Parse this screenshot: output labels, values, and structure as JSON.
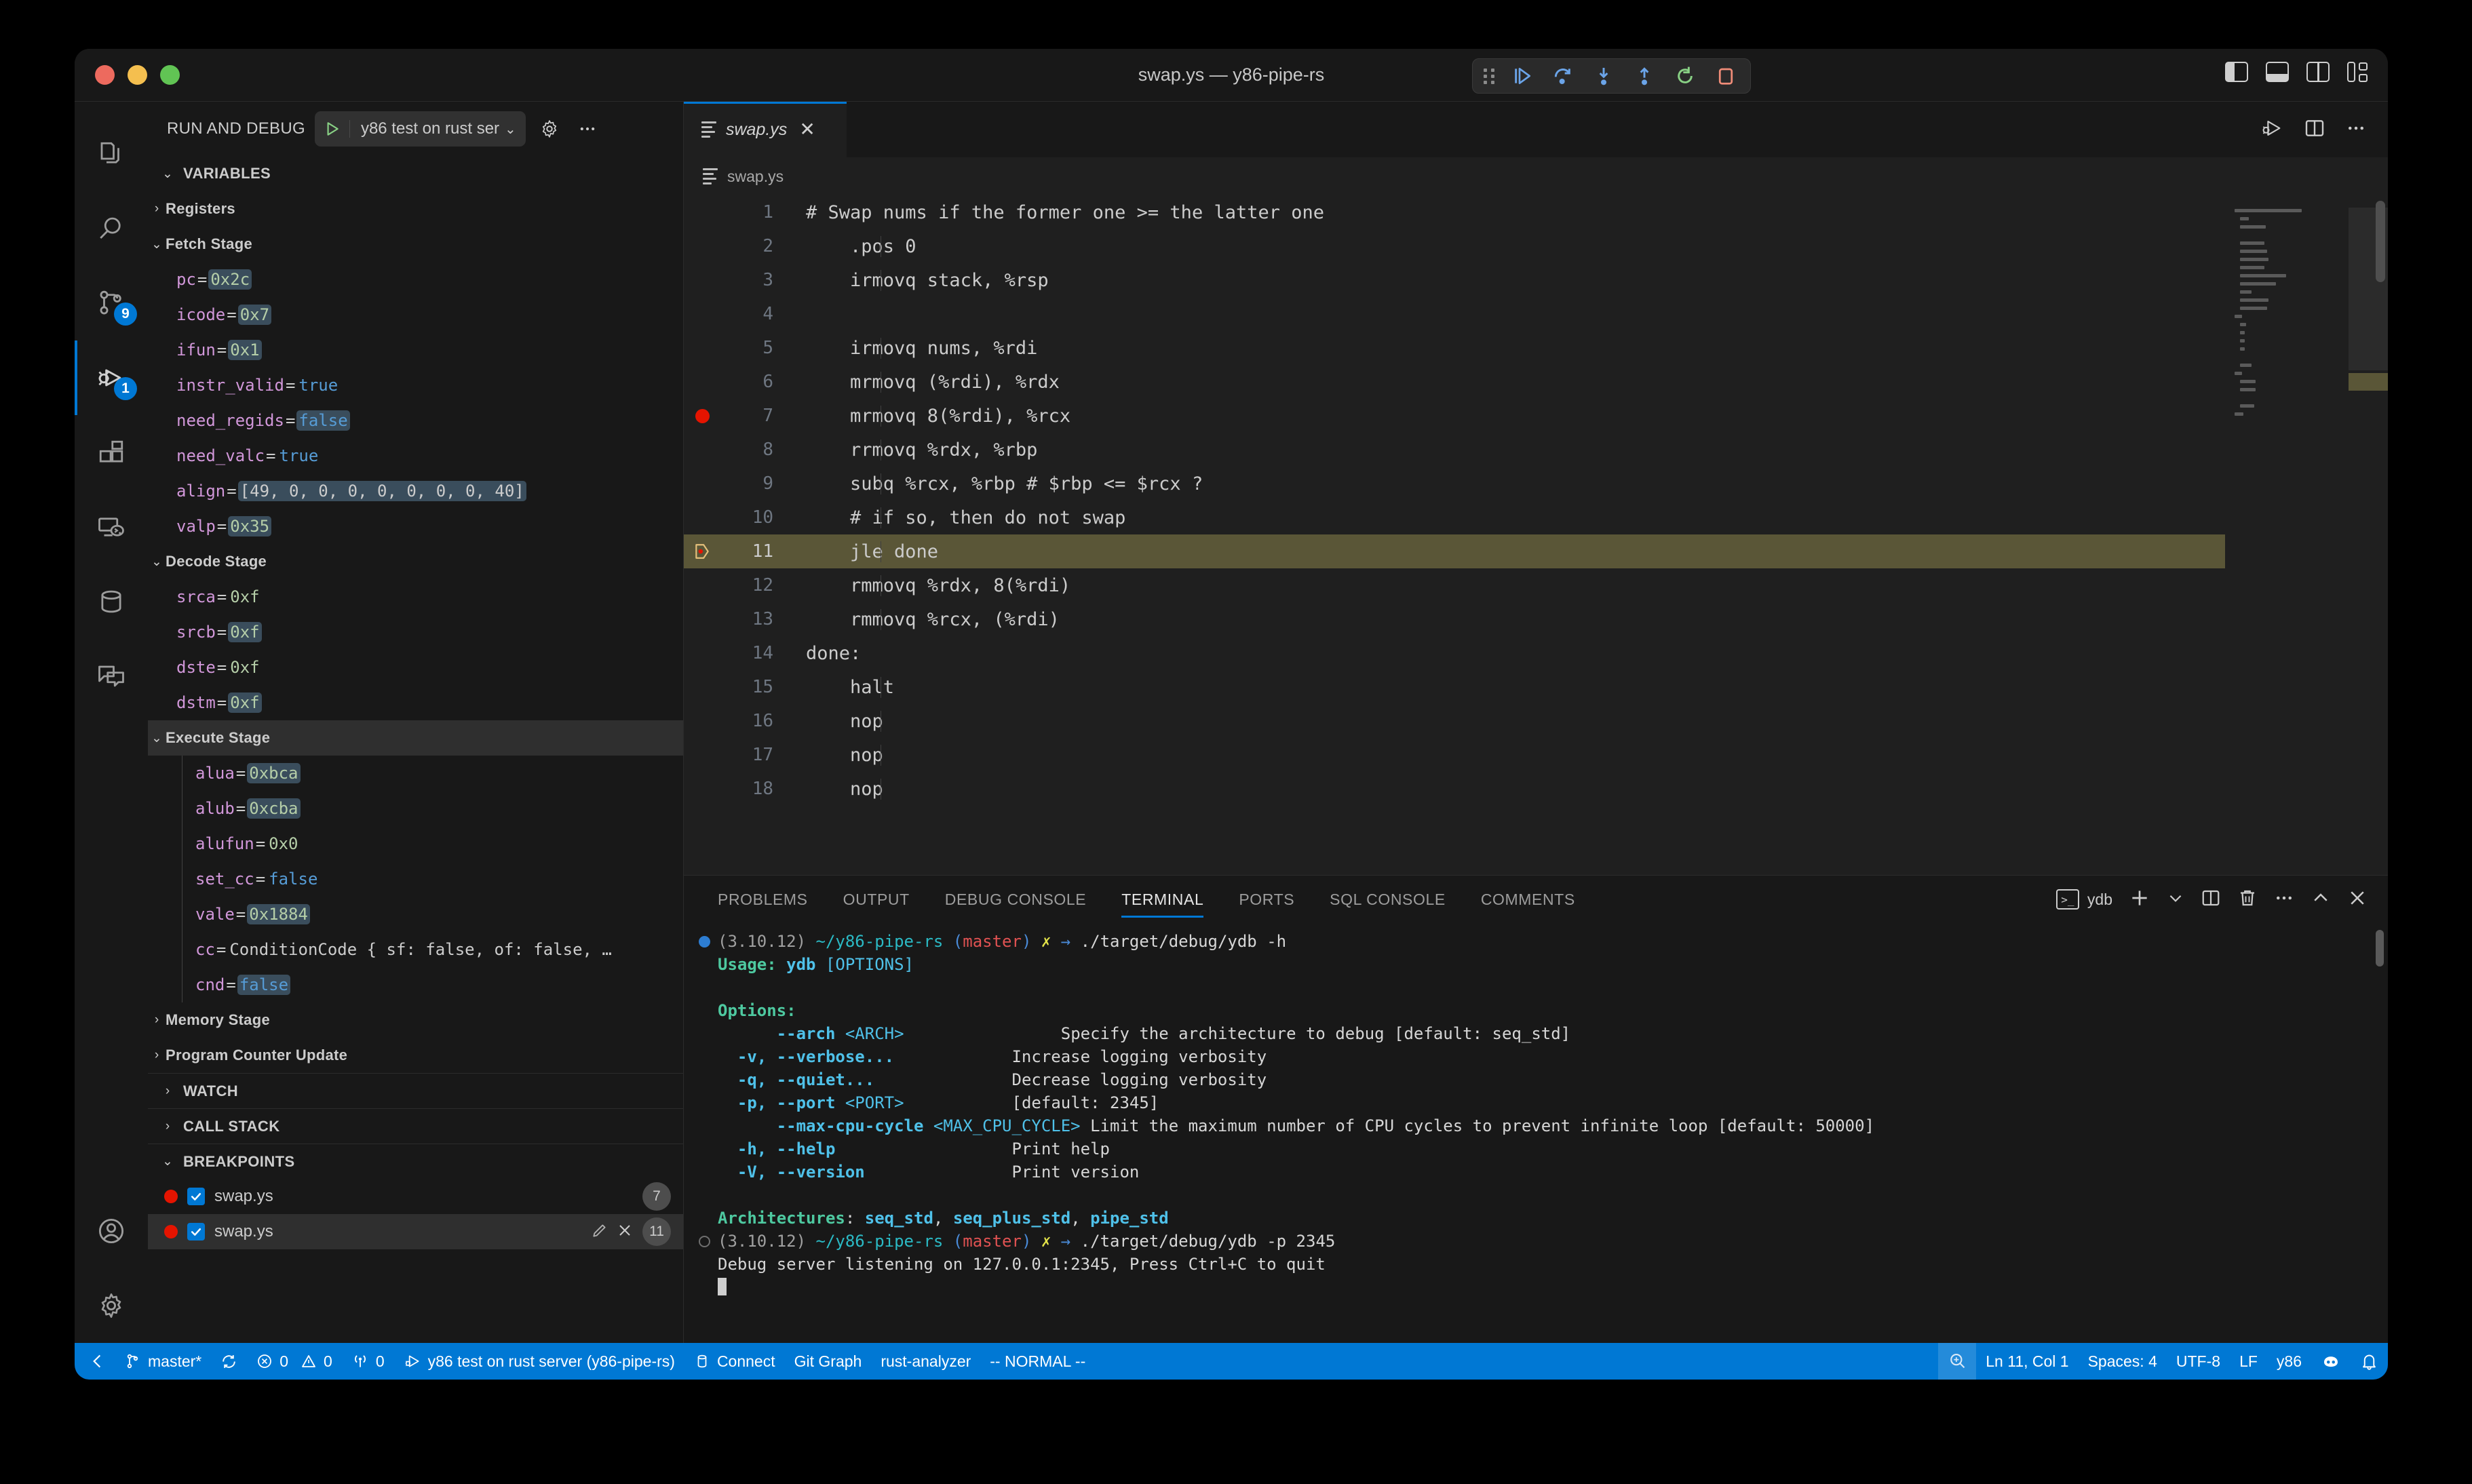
{
  "window": {
    "title": "swap.ys — y86-pipe-rs",
    "traffic_lights": [
      "close",
      "minimize",
      "maximize"
    ]
  },
  "debug_toolbar": {
    "buttons": [
      "continue",
      "step-over",
      "step-into",
      "step-out",
      "restart",
      "stop"
    ]
  },
  "layout_toggles": [
    "toggle-primary-sidebar",
    "toggle-panel",
    "toggle-secondary-sidebar",
    "customize-layout"
  ],
  "activity_bar": {
    "items": [
      {
        "name": "explorer",
        "badge": ""
      },
      {
        "name": "search",
        "badge": ""
      },
      {
        "name": "source-control",
        "badge": "9"
      },
      {
        "name": "run-and-debug",
        "badge": "1",
        "active": true
      },
      {
        "name": "extensions",
        "badge": ""
      },
      {
        "name": "remote-explorer",
        "badge": ""
      },
      {
        "name": "database",
        "badge": ""
      },
      {
        "name": "comments",
        "badge": ""
      }
    ],
    "bottom": [
      {
        "name": "accounts"
      },
      {
        "name": "settings"
      }
    ]
  },
  "sidebar": {
    "title": "RUN AND DEBUG",
    "launch_config": "y86 test on rust ser",
    "sections": {
      "variables": "VARIABLES",
      "watch": "WATCH",
      "call_stack": "CALL STACK",
      "breakpoints": "BREAKPOINTS"
    },
    "variable_groups": [
      {
        "label": "Registers",
        "expanded": false,
        "selected": false,
        "vars": []
      },
      {
        "label": "Fetch Stage",
        "expanded": true,
        "selected": false,
        "vars": [
          {
            "name": "pc",
            "value": "0x2c",
            "kind": "num",
            "changed": true
          },
          {
            "name": "icode",
            "value": "0x7",
            "kind": "num",
            "changed": true
          },
          {
            "name": "ifun",
            "value": "0x1",
            "kind": "num",
            "changed": true
          },
          {
            "name": "instr_valid",
            "value": "true",
            "kind": "bool",
            "changed": false
          },
          {
            "name": "need_regids",
            "value": "false",
            "kind": "bool",
            "changed": true
          },
          {
            "name": "need_valc",
            "value": "true",
            "kind": "bool",
            "changed": false
          },
          {
            "name": "align",
            "value": "[49, 0, 0, 0, 0, 0, 0, 0, 40]",
            "kind": "plain",
            "changed": true
          },
          {
            "name": "valp",
            "value": "0x35",
            "kind": "num",
            "changed": true
          }
        ]
      },
      {
        "label": "Decode Stage",
        "expanded": true,
        "selected": false,
        "vars": [
          {
            "name": "srca",
            "value": "0xf",
            "kind": "num",
            "changed": false
          },
          {
            "name": "srcb",
            "value": "0xf",
            "kind": "num",
            "changed": true
          },
          {
            "name": "dste",
            "value": "0xf",
            "kind": "num",
            "changed": false
          },
          {
            "name": "dstm",
            "value": "0xf",
            "kind": "num",
            "changed": true
          }
        ]
      },
      {
        "label": "Execute Stage",
        "expanded": true,
        "selected": true,
        "vars": [
          {
            "name": "alua",
            "value": "0xbca",
            "kind": "num",
            "changed": true
          },
          {
            "name": "alub",
            "value": "0xcba",
            "kind": "num",
            "changed": true
          },
          {
            "name": "alufun",
            "value": "0x0",
            "kind": "num",
            "changed": false
          },
          {
            "name": "set_cc",
            "value": "false",
            "kind": "bool",
            "changed": false
          },
          {
            "name": "vale",
            "value": "0x1884",
            "kind": "num",
            "changed": true
          },
          {
            "name": "cc",
            "value": "ConditionCode { sf: false, of: false, …",
            "kind": "plain",
            "changed": false
          },
          {
            "name": "cnd",
            "value": "false",
            "kind": "bool",
            "changed": true
          }
        ]
      },
      {
        "label": "Memory Stage",
        "expanded": false,
        "selected": false,
        "vars": []
      },
      {
        "label": "Program Counter Update",
        "expanded": false,
        "selected": false,
        "vars": []
      }
    ],
    "breakpoints": [
      {
        "file": "swap.ys",
        "enabled": true,
        "line": "7",
        "selected": false
      },
      {
        "file": "swap.ys",
        "enabled": true,
        "line": "11",
        "selected": true
      }
    ]
  },
  "editor": {
    "tab": {
      "label": "swap.ys",
      "preview": true
    },
    "breadcrumb": "swap.ys",
    "actions": [
      "run-debug-file-icon",
      "split-editor-icon",
      "more-actions-icon"
    ],
    "current_line": 11,
    "breakpoint_lines": [
      7
    ],
    "lines": [
      {
        "n": "1",
        "text": "# Swap nums if the former one >= the latter one"
      },
      {
        "n": "2",
        "text": "    .pos 0"
      },
      {
        "n": "3",
        "text": "    irmovq stack, %rsp"
      },
      {
        "n": "4",
        "text": ""
      },
      {
        "n": "5",
        "text": "    irmovq nums, %rdi"
      },
      {
        "n": "6",
        "text": "    mrmovq (%rdi), %rdx"
      },
      {
        "n": "7",
        "text": "    mrmovq 8(%rdi), %rcx"
      },
      {
        "n": "8",
        "text": "    rrmovq %rdx, %rbp"
      },
      {
        "n": "9",
        "text": "    subq %rcx, %rbp # $rbp <= $rcx ?"
      },
      {
        "n": "10",
        "text": "    # if so, then do not swap"
      },
      {
        "n": "11",
        "text": "    jle done"
      },
      {
        "n": "12",
        "text": "    rmmovq %rdx, 8(%rdi)"
      },
      {
        "n": "13",
        "text": "    rmmovq %rcx, (%rdi)"
      },
      {
        "n": "14",
        "text": "done:"
      },
      {
        "n": "15",
        "text": "    halt"
      },
      {
        "n": "16",
        "text": "    nop"
      },
      {
        "n": "17",
        "text": "    nop"
      },
      {
        "n": "18",
        "text": "    nop"
      }
    ]
  },
  "panel": {
    "tabs": [
      "PROBLEMS",
      "OUTPUT",
      "DEBUG CONSOLE",
      "TERMINAL",
      "PORTS",
      "SQL CONSOLE",
      "COMMENTS"
    ],
    "active_tab": "TERMINAL",
    "terminal_name": "ydb",
    "actions": [
      "new-terminal-icon",
      "terminal-dropdown-icon",
      "split-terminal-icon",
      "kill-terminal-icon",
      "more-actions-icon",
      "maximize-panel-icon",
      "close-panel-icon"
    ],
    "terminal_lines": [
      {
        "mark": "filled",
        "segs": [
          {
            "t": "(3.10.12) ",
            "c": "gray"
          },
          {
            "t": "~/y86-pipe-rs ",
            "c": "cyan"
          },
          {
            "t": "(",
            "c": "blue"
          },
          {
            "t": "master",
            "c": "red"
          },
          {
            "t": ")",
            "c": "blue"
          },
          {
            "t": " ✗ ",
            "c": "yellow"
          },
          {
            "t": "→ ",
            "c": "blue"
          },
          {
            "t": "./target/debug/ydb -h",
            "c": "white"
          }
        ]
      },
      {
        "mark": "",
        "segs": [
          {
            "t": "Usage: ",
            "c": "greenb"
          },
          {
            "t": "ydb ",
            "c": "cyan2b"
          },
          {
            "t": "[OPTIONS]",
            "c": "cyan2"
          }
        ]
      },
      {
        "mark": "",
        "segs": []
      },
      {
        "mark": "",
        "segs": [
          {
            "t": "Options:",
            "c": "greenb"
          }
        ]
      },
      {
        "mark": "",
        "segs": [
          {
            "t": "      ",
            "c": "white"
          },
          {
            "t": "--arch ",
            "c": "cyan2b"
          },
          {
            "t": "<ARCH>",
            "c": "cyan2"
          },
          {
            "t": "                ",
            "c": "white"
          },
          {
            "t": "Specify the architecture to debug [default: seq_std]",
            "c": "white"
          }
        ]
      },
      {
        "mark": "",
        "segs": [
          {
            "t": "  ",
            "c": "white"
          },
          {
            "t": "-v, --verbose...",
            "c": "cyan2b"
          },
          {
            "t": "            ",
            "c": "white"
          },
          {
            "t": "Increase logging verbosity",
            "c": "white"
          }
        ]
      },
      {
        "mark": "",
        "segs": [
          {
            "t": "  ",
            "c": "white"
          },
          {
            "t": "-q, --quiet...",
            "c": "cyan2b"
          },
          {
            "t": "              ",
            "c": "white"
          },
          {
            "t": "Decrease logging verbosity",
            "c": "white"
          }
        ]
      },
      {
        "mark": "",
        "segs": [
          {
            "t": "  ",
            "c": "white"
          },
          {
            "t": "-p, --port ",
            "c": "cyan2b"
          },
          {
            "t": "<PORT>",
            "c": "cyan2"
          },
          {
            "t": "           ",
            "c": "white"
          },
          {
            "t": "[default: 2345]",
            "c": "white"
          }
        ]
      },
      {
        "mark": "",
        "segs": [
          {
            "t": "      ",
            "c": "white"
          },
          {
            "t": "--max-cpu-cycle ",
            "c": "cyan2b"
          },
          {
            "t": "<MAX_CPU_CYCLE>",
            "c": "cyan2"
          },
          {
            "t": " ",
            "c": "white"
          },
          {
            "t": "Limit the maximum number of CPU cycles to prevent infinite loop [default: 50000]",
            "c": "white"
          }
        ]
      },
      {
        "mark": "",
        "segs": [
          {
            "t": "  ",
            "c": "white"
          },
          {
            "t": "-h, --help",
            "c": "cyan2b"
          },
          {
            "t": "                  ",
            "c": "white"
          },
          {
            "t": "Print help",
            "c": "white"
          }
        ]
      },
      {
        "mark": "",
        "segs": [
          {
            "t": "  ",
            "c": "white"
          },
          {
            "t": "-V, --version",
            "c": "cyan2b"
          },
          {
            "t": "               ",
            "c": "white"
          },
          {
            "t": "Print version",
            "c": "white"
          }
        ]
      },
      {
        "mark": "",
        "segs": []
      },
      {
        "mark": "",
        "segs": [
          {
            "t": "Architectures",
            "c": "greenb"
          },
          {
            "t": ": ",
            "c": "white"
          },
          {
            "t": "seq_std",
            "c": "cyan2b"
          },
          {
            "t": ", ",
            "c": "white"
          },
          {
            "t": "seq_plus_std",
            "c": "cyan2b"
          },
          {
            "t": ", ",
            "c": "white"
          },
          {
            "t": "pipe_std",
            "c": "cyan2b"
          }
        ]
      },
      {
        "mark": "hollow",
        "segs": [
          {
            "t": "(3.10.12) ",
            "c": "gray"
          },
          {
            "t": "~/y86-pipe-rs ",
            "c": "cyan"
          },
          {
            "t": "(",
            "c": "blue"
          },
          {
            "t": "master",
            "c": "red"
          },
          {
            "t": ")",
            "c": "blue"
          },
          {
            "t": " ✗ ",
            "c": "yellow"
          },
          {
            "t": "→ ",
            "c": "blue"
          },
          {
            "t": "./target/debug/ydb -p 2345",
            "c": "white"
          }
        ]
      },
      {
        "mark": "",
        "segs": [
          {
            "t": "Debug server listening on 127.0.0.1:2345, Press Ctrl+C to quit",
            "c": "white"
          }
        ]
      },
      {
        "mark": "",
        "segs": [],
        "cursor": true
      }
    ]
  },
  "statusbar": {
    "left": [
      {
        "name": "remote-indicator",
        "icon": "remote-icon",
        "label": ""
      },
      {
        "name": "branch",
        "icon": "branch-icon",
        "label": "master*"
      },
      {
        "name": "sync",
        "icon": "sync-icon",
        "label": ""
      },
      {
        "name": "errors-warnings",
        "icon": "error-icon",
        "label": "0",
        "icon2": "warning-icon",
        "label2": "0"
      },
      {
        "name": "radio-tower",
        "icon": "radio-tower-icon",
        "label": "0"
      },
      {
        "name": "debug-session",
        "icon": "debug-icon",
        "label": "y86 test on rust server (y86-pipe-rs)"
      },
      {
        "name": "connect",
        "icon": "database-icon",
        "label": "Connect"
      },
      {
        "name": "git-graph",
        "icon": "",
        "label": "Git Graph"
      },
      {
        "name": "rust-analyzer",
        "icon": "",
        "label": "rust-analyzer"
      },
      {
        "name": "vim-mode",
        "icon": "",
        "label": "-- NORMAL --"
      }
    ],
    "right": [
      {
        "name": "screencast-zoom",
        "icon": "zoom-icon",
        "label": "",
        "highlighted": true
      },
      {
        "name": "cursor-position",
        "icon": "",
        "label": "Ln 11, Col 1"
      },
      {
        "name": "indentation",
        "icon": "",
        "label": "Spaces: 4"
      },
      {
        "name": "encoding",
        "icon": "",
        "label": "UTF-8"
      },
      {
        "name": "eol",
        "icon": "",
        "label": "LF"
      },
      {
        "name": "language-mode",
        "icon": "",
        "label": "y86"
      },
      {
        "name": "copilot",
        "icon": "copilot-icon",
        "label": ""
      },
      {
        "name": "notifications",
        "icon": "bell-icon",
        "label": ""
      }
    ]
  },
  "colors": {
    "accent": "#0078d4",
    "breakpoint": "#e51400",
    "current_line": "#5a5637",
    "changed_value": "#3a4d5c"
  }
}
